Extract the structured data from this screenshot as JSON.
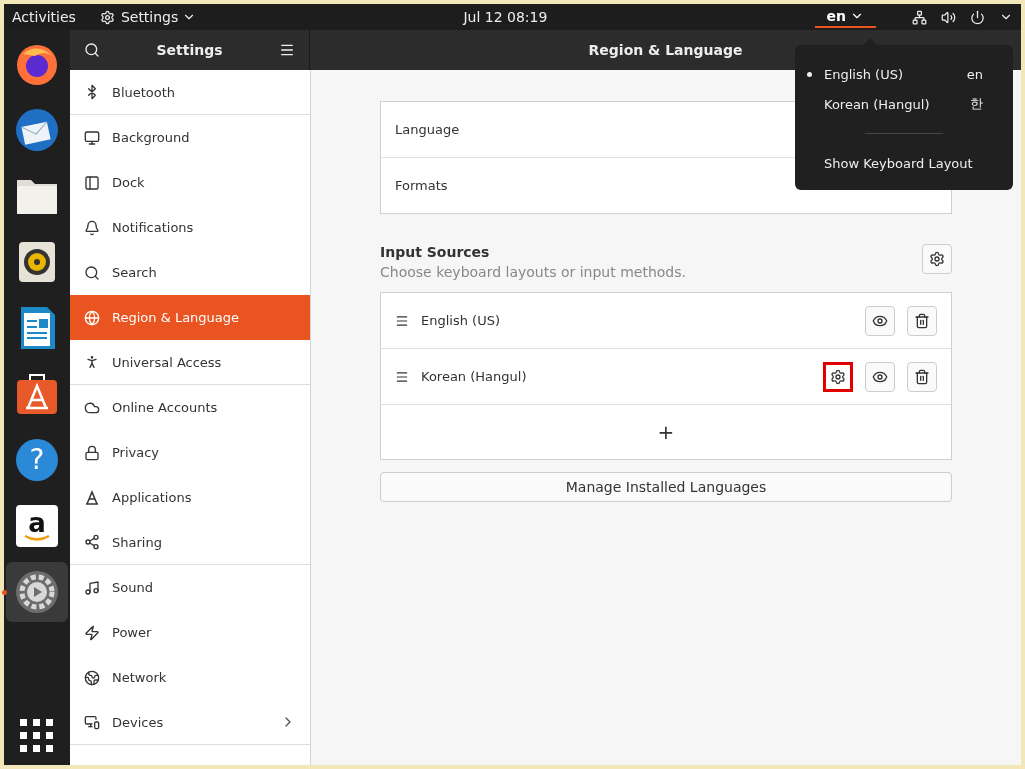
{
  "top_bar": {
    "activities": "Activities",
    "app_menu": "Settings",
    "clock": "Jul 12  08:19",
    "input_indicator": "en",
    "indicator_open": true
  },
  "sidebar": {
    "title": "Settings",
    "items": [
      {
        "label": "Bluetooth",
        "selected": false,
        "divider_after": true
      },
      {
        "label": "Background",
        "selected": false,
        "divider_after": false
      },
      {
        "label": "Dock",
        "selected": false,
        "divider_after": false
      },
      {
        "label": "Notifications",
        "selected": false,
        "divider_after": false
      },
      {
        "label": "Search",
        "selected": false,
        "divider_after": false
      },
      {
        "label": "Region & Language",
        "selected": true,
        "divider_after": false
      },
      {
        "label": "Universal Access",
        "selected": false,
        "divider_after": true
      },
      {
        "label": "Online Accounts",
        "selected": false,
        "divider_after": false
      },
      {
        "label": "Privacy",
        "selected": false,
        "divider_after": false
      },
      {
        "label": "Applications",
        "selected": false,
        "divider_after": false
      },
      {
        "label": "Sharing",
        "selected": false,
        "divider_after": true
      },
      {
        "label": "Sound",
        "selected": false,
        "divider_after": false
      },
      {
        "label": "Power",
        "selected": false,
        "divider_after": false
      },
      {
        "label": "Network",
        "selected": false,
        "divider_after": false
      },
      {
        "label": "Devices",
        "selected": false,
        "divider_after": true,
        "has_submenu": true
      }
    ]
  },
  "dock": {
    "items": [
      {
        "kind": "firefox",
        "running": false
      },
      {
        "kind": "mail",
        "running": false
      },
      {
        "kind": "folder",
        "running": false
      },
      {
        "kind": "speaker",
        "running": false
      },
      {
        "kind": "writer",
        "running": false
      },
      {
        "kind": "store",
        "running": false
      },
      {
        "kind": "help",
        "glyph": "?",
        "running": false
      },
      {
        "kind": "amazon",
        "glyph": "a",
        "running": false
      },
      {
        "kind": "settings",
        "running": true
      }
    ]
  },
  "main": {
    "title": "Region & Language",
    "settings_rows": [
      {
        "label": "Language"
      },
      {
        "label": "Formats"
      }
    ],
    "input_sources": {
      "heading": "Input Sources",
      "subtitle": "Choose keyboard layouts or input methods.",
      "sources": [
        {
          "name": "English (US)",
          "has_settings": false
        },
        {
          "name": "Korean (Hangul)",
          "has_settings": true,
          "highlighted": true
        }
      ],
      "add_label": "+"
    },
    "manage_button": "Manage Installed Languages"
  },
  "input_menu": {
    "items": [
      {
        "label": "English (US)",
        "short": "en",
        "selected": true
      },
      {
        "label": "Korean (Hangul)",
        "short": "한",
        "selected": false
      }
    ],
    "show_layout": "Show Keyboard Layout"
  }
}
